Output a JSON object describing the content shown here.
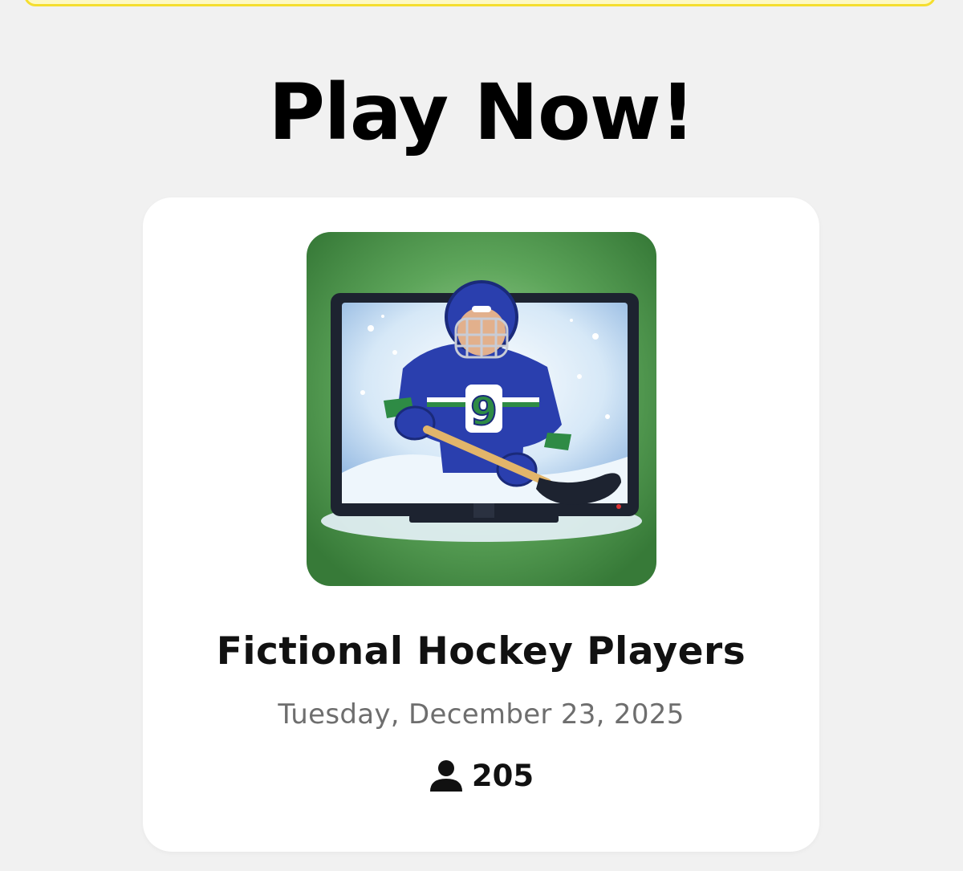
{
  "colors": {
    "page_background": "#f1f1f1",
    "banner_border": "#f5de2e",
    "card_background": "#ffffff",
    "title_text": "#000000",
    "date_text": "#6e6e6e",
    "thumbnail_green": "#3f8a3f",
    "jersey_blue": "#2a3fae",
    "jersey_green": "#2e8b45"
  },
  "header": {
    "title": "Play Now!"
  },
  "game_card": {
    "thumbnail_icon": "hockey-player-tv-icon",
    "jersey_number": "9",
    "title": "Fictional Hockey Players",
    "date": "Tuesday, December 23, 2025",
    "players_icon": "user-icon",
    "players_count": "205"
  }
}
